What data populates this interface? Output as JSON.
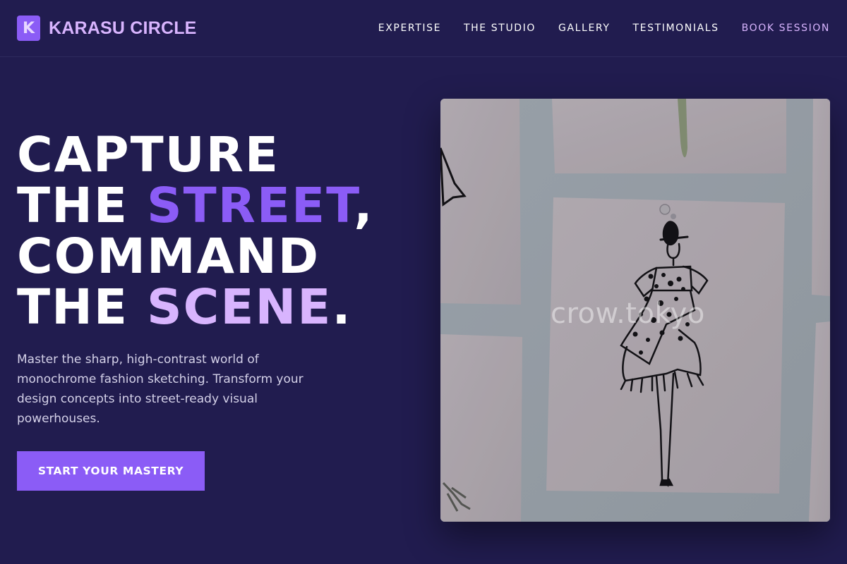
{
  "brand": {
    "logo_letter": "K",
    "name": "KARASU CIRCLE"
  },
  "nav": {
    "links": [
      "EXPERTISE",
      "THE STUDIO",
      "GALLERY",
      "TESTIMONIALS"
    ],
    "book_session": "BOOK SESSION"
  },
  "hero": {
    "headline": {
      "line1": "CAPTURE",
      "line2_a": "THE ",
      "line2_b": "STREET",
      "line2_c": ",",
      "line3": "COMMAND",
      "line4_a": "THE ",
      "line4_b": "SCENE",
      "line4_c": "."
    },
    "subtext": "Master the sharp, high-contrast world of monochrome fashion sketching. Transform your design concepts into street-ready visual powerhouses.",
    "cta": "START YOUR MASTERY",
    "image": {
      "watermark": "crow.tokyo"
    }
  },
  "colors": {
    "background": "#211c4f",
    "accent": "#8b5cf6",
    "accent_light": "#d8b4fe"
  }
}
